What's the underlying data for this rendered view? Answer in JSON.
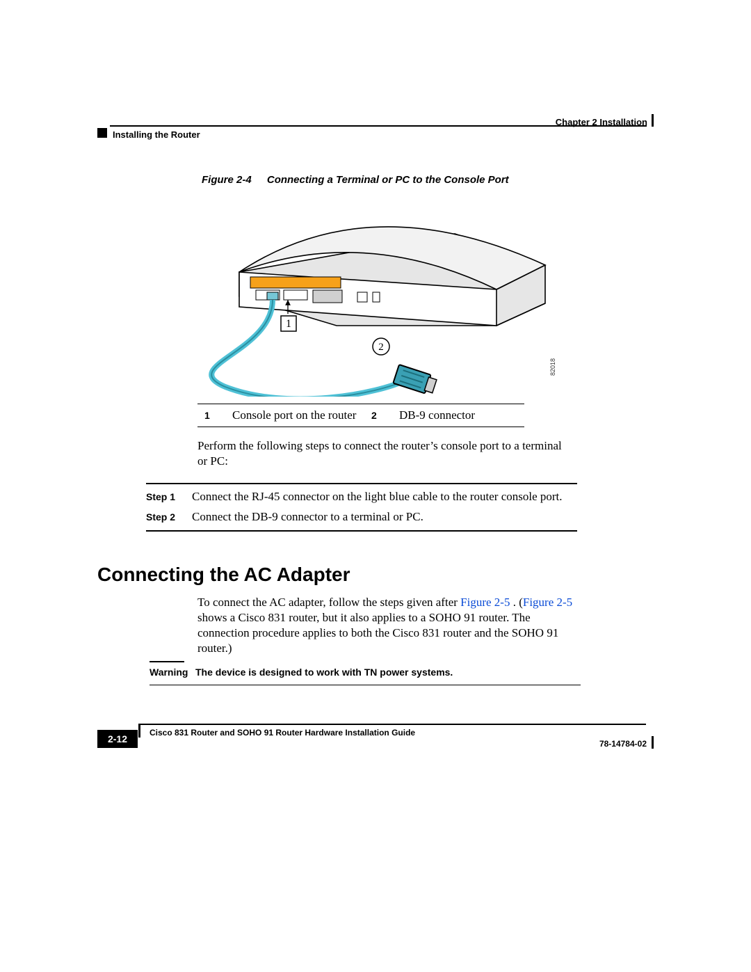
{
  "header": {
    "chapter": "Chapter 2    Installation",
    "section": "Installing the Router"
  },
  "figure": {
    "label": "Figure 2-4",
    "title": "Connecting a Terminal or PC to the Console Port",
    "illustration_id": "82018",
    "callouts": {
      "c1_num": "1",
      "c1_txt": "Console port on the router",
      "c2_num": "2",
      "c2_txt": "DB-9 connector"
    }
  },
  "body": {
    "intro": "Perform the following steps to connect the router’s console port to a terminal or PC:",
    "steps": [
      {
        "label": "Step 1",
        "text": "Connect the RJ-45 connector on the light blue cable to the router console port."
      },
      {
        "label": "Step 2",
        "text": "Connect the DB-9 connector to a terminal or PC."
      }
    ]
  },
  "section_heading": "Connecting the AC Adapter",
  "ac_text": {
    "pre": "To connect the AC adapter, follow the steps given after ",
    "link1": "Figure 2-5",
    "mid": ". (",
    "link2": "Figure 2-5",
    "post": " shows a Cisco 831 router, but it also applies to a SOHO 91 router. The connection procedure applies to both the Cisco 831 router and the SOHO 91 router.)"
  },
  "caution": {
    "label": "Warning",
    "text": "The device is designed to work with TN power systems."
  },
  "footer": {
    "title": "Cisco 831 Router and SOHO 91 Router Hardware Installation Guide",
    "docno": "78-14784-02",
    "page": "2-12"
  }
}
